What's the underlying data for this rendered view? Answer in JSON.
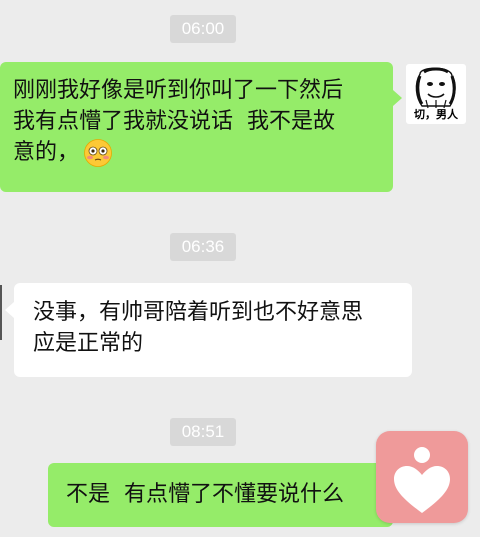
{
  "timestamps": [
    "06:00",
    "06:36",
    "08:51"
  ],
  "messages": [
    {
      "side": "sent",
      "lines": [
        "刚刚我好像是听到你叫了一下然后",
        "我有点懵了我就没说话  我不是故",
        "意的，"
      ],
      "emoji": "flushed-face"
    },
    {
      "side": "received",
      "lines": [
        "没事，有帅哥陪着听到也不好意思",
        "应是正常的"
      ]
    },
    {
      "side": "sent",
      "lines": [
        "不是  有点懵了不懂要说什么"
      ]
    }
  ],
  "avatar": {
    "caption": "切，男人"
  },
  "overlay": {
    "icon": "heart-icon",
    "color": "#ef9a9a"
  },
  "colors": {
    "background": "#ececec",
    "sent_bubble": "#95ec69",
    "received_bubble": "#ffffff",
    "timestamp_bg": "#d8d8d8"
  }
}
